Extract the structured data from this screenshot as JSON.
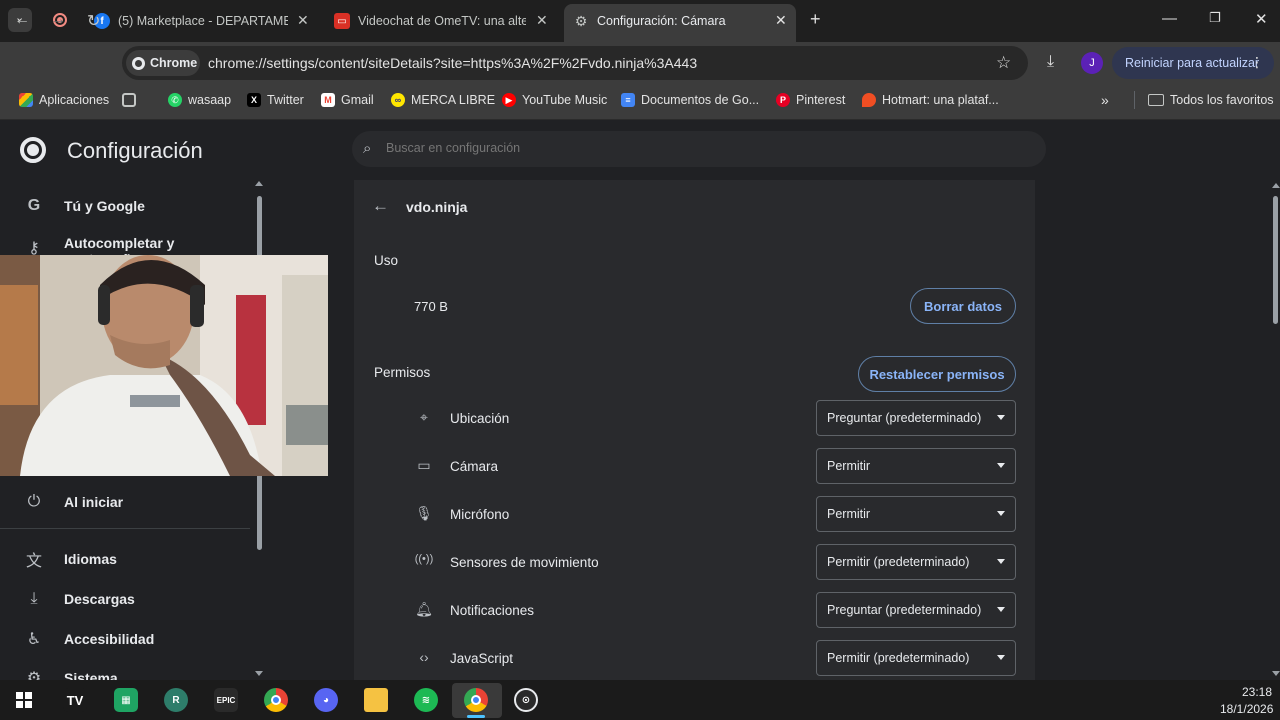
{
  "tabs": [
    {
      "title": "(5) Marketplace - DEPARTAMEN",
      "icon": "facebook-icon",
      "color": "#1877f2"
    },
    {
      "title": "Videochat de OmeTV: una alter",
      "icon": "ometv-icon",
      "color": "#d93025"
    },
    {
      "title": "Configuración: Cámara",
      "icon": "gear-icon",
      "color": "#9aa0a6",
      "active": true
    }
  ],
  "toolbar": {
    "chip_label": "Chrome",
    "url_host": "chrome://",
    "url_path": "settings/content/siteDetails?site=https%3A%2F%2Fvdo.ninja%3A443",
    "avatar_letter": "J",
    "update_label": "Reiniciar para actualizar"
  },
  "bookmarks": {
    "items": [
      {
        "label": "Aplicaciones",
        "icon": "apps-grid-icon"
      },
      {
        "label": "wasaap",
        "icon": "whatsapp-icon"
      },
      {
        "label": "Twitter",
        "icon": "x-icon"
      },
      {
        "label": "Gmail",
        "icon": "gmail-icon"
      },
      {
        "label": "MERCA LIBRE",
        "icon": "mercadolibre-icon"
      },
      {
        "label": "YouTube Music",
        "icon": "youtube-music-icon"
      },
      {
        "label": "Documentos de Go...",
        "icon": "docs-icon"
      },
      {
        "label": "Pinterest",
        "icon": "pinterest-icon"
      },
      {
        "label": "Hotmart: una plataf...",
        "icon": "hotmart-icon"
      }
    ],
    "all_label": "Todos los favoritos"
  },
  "settings": {
    "title": "Configuración",
    "search_placeholder": "Buscar en configuración"
  },
  "sidebar": {
    "items": [
      {
        "label": "Tú y Google",
        "icon": "google-icon"
      },
      {
        "label": "Autocompletar y contraseñas",
        "icon": "key-icon"
      },
      {
        "label": "Al iniciar",
        "icon": "power-icon"
      },
      {
        "label": "Idiomas",
        "icon": "translate-icon"
      },
      {
        "label": "Descargas",
        "icon": "download-icon"
      },
      {
        "label": "Accesibilidad",
        "icon": "accessibility-icon"
      },
      {
        "label": "Sistema",
        "icon": "system-icon"
      }
    ]
  },
  "site": {
    "name": "vdo.ninja",
    "usage_heading": "Uso",
    "usage_value": "770 B",
    "clear_data_label": "Borrar datos",
    "permissions_heading": "Permisos",
    "reset_permissions_label": "Restablecer permisos",
    "permissions": [
      {
        "label": "Ubicación",
        "value": "Preguntar (predeterminado)",
        "icon": "location-icon"
      },
      {
        "label": "Cámara",
        "value": "Permitir",
        "icon": "camera-icon"
      },
      {
        "label": "Micrófono",
        "value": "Permitir",
        "icon": "microphone-icon"
      },
      {
        "label": "Sensores de movimiento",
        "value": "Permitir (predeterminado)",
        "icon": "sensors-icon"
      },
      {
        "label": "Notificaciones",
        "value": "Preguntar (predeterminado)",
        "icon": "bell-icon"
      },
      {
        "label": "JavaScript",
        "value": "Permitir (predeterminado)",
        "icon": "code-icon"
      }
    ]
  },
  "taskbar": {
    "time": "23:18",
    "date": "18/1/2026"
  }
}
